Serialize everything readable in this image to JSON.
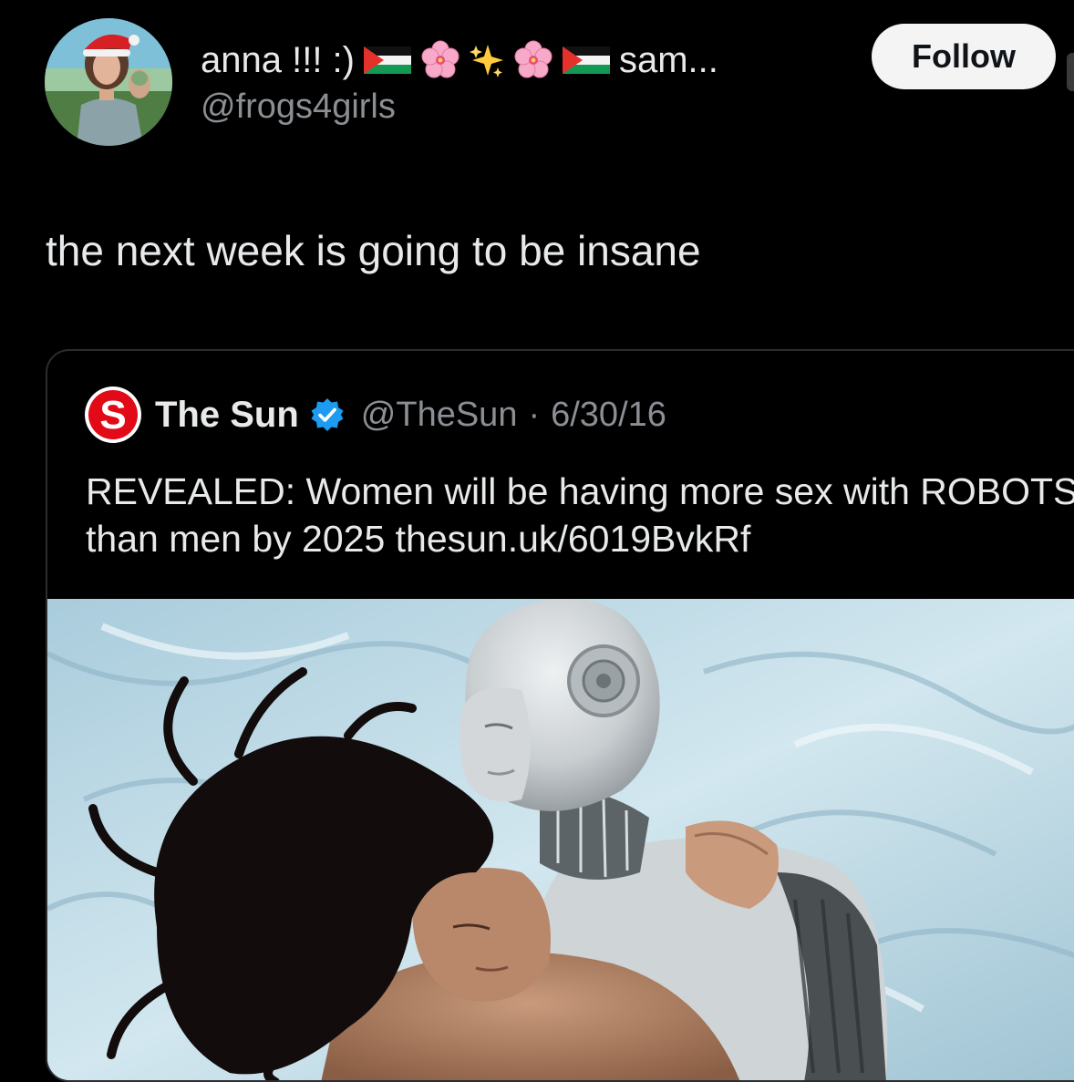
{
  "post": {
    "author": {
      "display_name": "anna !!! :)",
      "display_name_tail": "sam...",
      "handle": "@frogs4girls",
      "name_emojis": [
        "palestine-flag",
        "cherry-blossom",
        "sparkles",
        "cherry-blossom",
        "palestine-flag"
      ]
    },
    "follow_label": "Follow",
    "text": "the next week is going to be insane"
  },
  "quoted": {
    "name": "The Sun",
    "handle": "@TheSun",
    "separator": "·",
    "date": "6/30/16",
    "text": "REVEALED: Women will be having more sex with ROBOTS than men by 2025 thesun.uk/6019BvkRf",
    "logo_letter": "S",
    "verified": true
  },
  "colors": {
    "background": "#000000",
    "text_primary": "#e7e9ea",
    "text_secondary": "#8b8f94",
    "follow_bg": "#f4f4f4",
    "sun_red": "#e20a16",
    "verified_blue": "#1d9bf0"
  }
}
